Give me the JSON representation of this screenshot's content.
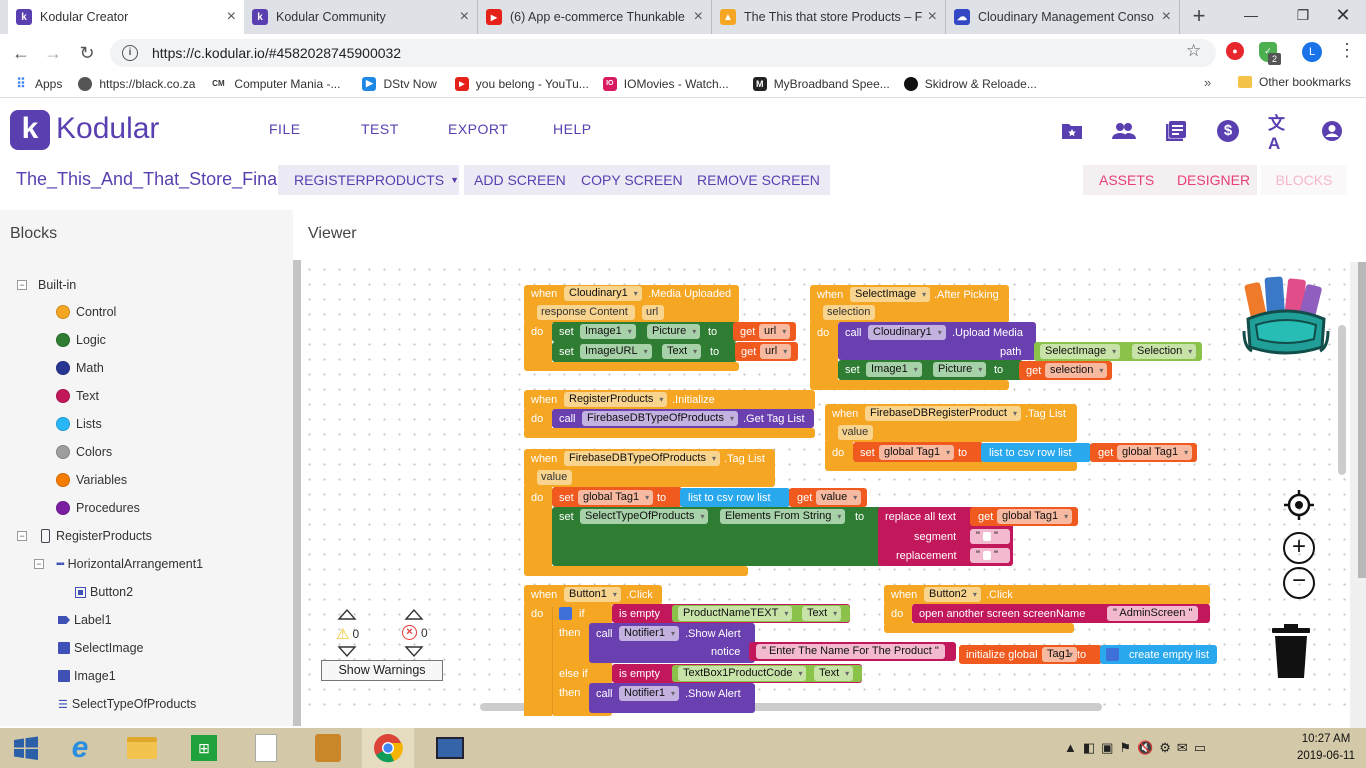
{
  "browser": {
    "tabs": [
      {
        "title": "Kodular Creator",
        "favicon": "kodular-icon",
        "color": "#5a3fb0",
        "glyph": "k"
      },
      {
        "title": "Kodular Community",
        "favicon": "kodular-icon",
        "color": "#5a3fb0",
        "glyph": "k"
      },
      {
        "title": "(6) App e-commerce Thunkable",
        "favicon": "youtube-icon",
        "color": "#e62117",
        "glyph": "▶"
      },
      {
        "title": "The This that store Products – F",
        "favicon": "firebase-icon",
        "color": "#f5a623",
        "glyph": "▲"
      },
      {
        "title": "Cloudinary Management Conso",
        "favicon": "cloudinary-icon",
        "color": "#3448c5",
        "glyph": "☁"
      }
    ],
    "url": "https://c.kodular.io/#4582028745900032",
    "extension_badge": "2",
    "profile_initial": "L",
    "bookmarks": [
      {
        "label": "Apps",
        "color": "#4285f4",
        "glyph": "⋮"
      },
      {
        "label": "https://black.co.za",
        "color": "#555",
        "glyph": "●"
      },
      {
        "label": "Computer Mania -...",
        "color": "#333",
        "glyph": "CM"
      },
      {
        "label": "DStv Now",
        "color": "#1e88e5",
        "glyph": "▶"
      },
      {
        "label": "you belong - YouTu...",
        "color": "#e62117",
        "glyph": "▶"
      },
      {
        "label": "IOMovies - Watch...",
        "color": "#d81b60",
        "glyph": "IO"
      },
      {
        "label": "MyBroadband Spee...",
        "color": "#222",
        "glyph": "M"
      },
      {
        "label": "Skidrow & Reloade...",
        "color": "#111",
        "glyph": "●"
      }
    ],
    "other_bookmarks": "Other bookmarks"
  },
  "kodular": {
    "brand": "Kodular",
    "menu": [
      "FILE",
      "TEST",
      "EXPORT",
      "HELP"
    ],
    "project_name": "The_This_And_That_Store_Final",
    "screen_select": "REGISTERPRODUCTS",
    "screen_buttons": [
      "ADD SCREEN",
      "COPY SCREEN",
      "REMOVE SCREEN"
    ],
    "view_buttons": [
      "ASSETS",
      "DESIGNER",
      "BLOCKS"
    ],
    "accent": "#5a3fb0",
    "pink": "#e83f78"
  },
  "panels": {
    "blocks_title": "Blocks",
    "viewer_title": "Viewer"
  },
  "builtin": {
    "label": "Built-in",
    "items": [
      {
        "label": "Control",
        "color": "#f5a623"
      },
      {
        "label": "Logic",
        "color": "#2e7d32"
      },
      {
        "label": "Math",
        "color": "#283593"
      },
      {
        "label": "Text",
        "color": "#c2185b"
      },
      {
        "label": "Lists",
        "color": "#29b6f6"
      },
      {
        "label": "Colors",
        "color": "#9e9e9e"
      },
      {
        "label": "Variables",
        "color": "#f57c00"
      },
      {
        "label": "Procedures",
        "color": "#7b1fa2"
      }
    ]
  },
  "components": {
    "screen": "RegisterProducts",
    "arrangement": "HorizontalArrangement1",
    "button": "Button2",
    "items": [
      "Label1",
      "SelectImage",
      "Image1",
      "SelectTypeOfProducts"
    ]
  },
  "warnings": {
    "warn_count": "0",
    "error_count": "0",
    "show_label": "Show Warnings"
  },
  "blocks": {
    "b1": {
      "when": "when",
      "comp": "Cloudinary1",
      "event": ".Media Uploaded",
      "p1": "response Content",
      "p2": "url",
      "do": "do",
      "set": "set",
      "c1": "Image1",
      "f1": "Picture",
      "to": "to",
      "get": "get",
      "g1": "url",
      "c2": "ImageURL",
      "f2": "Text",
      "g2": "url"
    },
    "b2": {
      "when": "when",
      "comp": "SelectImage",
      "event": ".After Picking",
      "p1": "selection",
      "do": "do",
      "call": "call",
      "ccomp": "Cloudinary1",
      "method": ".Upload Media",
      "path": "path",
      "sel_comp": "SelectImage",
      "sel_prop": "Selection",
      "set": "set",
      "c1": "Image1",
      "f1": "Picture",
      "to": "to",
      "get": "get",
      "g1": "selection"
    },
    "b3": {
      "when": "when",
      "comp": "RegisterProducts",
      "event": ".Initialize",
      "do": "do",
      "call": "call",
      "ccomp": "FirebaseDBTypeOfProducts",
      "method": ".Get Tag List"
    },
    "b4": {
      "when": "when",
      "comp": "FirebaseDBRegisterProduct",
      "event": ".Tag List",
      "p1": "value",
      "do": "do",
      "set": "set",
      "var": "global Tag1",
      "to": "to",
      "csv": "list to csv row  list",
      "get": "get",
      "gvar": "global Tag1"
    },
    "b5": {
      "when": "when",
      "comp": "FirebaseDBTypeOfProducts",
      "event": ".Tag List",
      "p1": "value",
      "do": "do",
      "set": "set",
      "var": "global Tag1",
      "to": "to",
      "csv": "list to csv row  list",
      "get": "get",
      "gval": "value",
      "c2": "SelectTypeOfProducts",
      "f2": "Elements From String",
      "replace": "replace all text",
      "gvar": "global Tag1",
      "segment": "segment",
      "replacement": "replacement"
    },
    "b6": {
      "when": "when",
      "comp": "Button1",
      "event": ".Click",
      "do": "do",
      "if": "if",
      "isempty": "is empty",
      "c1": "ProductNameTEXT",
      "f1": "Text",
      "then": "then",
      "call": "call",
      "ccomp": "Notifier1",
      "method": ".Show Alert",
      "notice": "notice",
      "msg": "Enter The Name For The Product",
      "elseif": "else if",
      "c2": "TextBox1ProductCode",
      "f2": "Text"
    },
    "b7": {
      "when": "when",
      "comp": "Button2",
      "event": ".Click",
      "do": "do",
      "open": "open another screen  screenName",
      "screen": "AdminScreen"
    },
    "b8": {
      "init": "initialize global",
      "var": "Tag1",
      "to": "to",
      "list": "create empty list"
    }
  },
  "taskbar": {
    "time": "10:27 AM",
    "date": "2019-06-11"
  }
}
